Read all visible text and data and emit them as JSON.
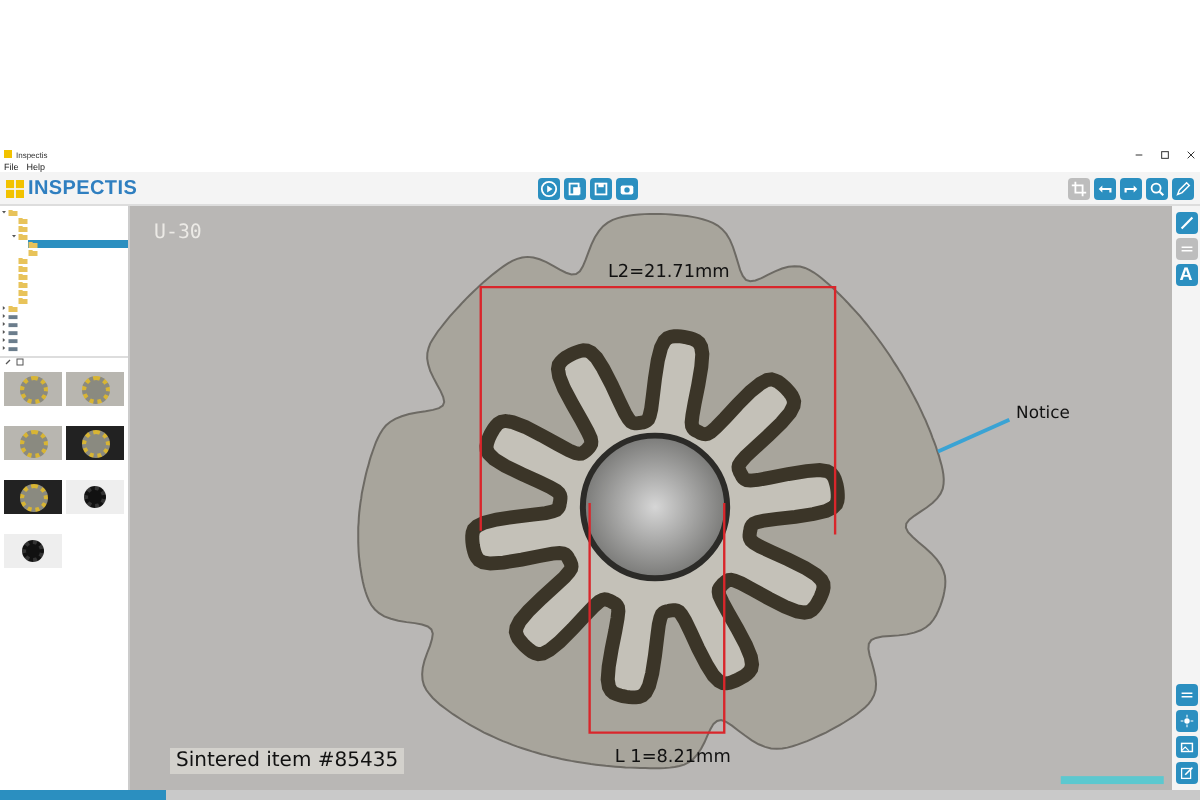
{
  "window": {
    "title": "Inspectis"
  },
  "menu": [
    "File",
    "Help"
  ],
  "logo": {
    "text": "INSPECTIS"
  },
  "center_tools": [
    {
      "kind": "play",
      "disabled": false
    },
    {
      "kind": "copy",
      "disabled": false
    },
    {
      "kind": "save",
      "disabled": false
    },
    {
      "kind": "camera",
      "disabled": false
    }
  ],
  "right_tools": [
    {
      "kind": "crop",
      "disabled": true
    },
    {
      "kind": "undo",
      "disabled": false
    },
    {
      "kind": "redo",
      "disabled": false
    },
    {
      "kind": "zoom",
      "disabled": false
    },
    {
      "kind": "pen",
      "disabled": false
    }
  ],
  "tree": [
    {
      "kind": "folder",
      "selected": false,
      "expanded": true,
      "children": [
        {
          "kind": "folder",
          "selected": false
        },
        {
          "kind": "folder",
          "selected": false
        },
        {
          "kind": "folder",
          "selected": false,
          "expanded": true,
          "children": [
            {
              "kind": "folder",
              "selected": true
            },
            {
              "kind": "folder",
              "selected": false
            }
          ]
        },
        {
          "kind": "folder",
          "selected": false
        },
        {
          "kind": "folder",
          "selected": false
        },
        {
          "kind": "folder",
          "selected": false
        },
        {
          "kind": "folder",
          "selected": false
        },
        {
          "kind": "folder",
          "selected": false
        },
        {
          "kind": "folder",
          "selected": false
        }
      ]
    },
    {
      "kind": "folder",
      "selected": false,
      "expanded": false
    },
    {
      "kind": "drive",
      "selected": false,
      "expanded": false
    },
    {
      "kind": "drive",
      "selected": false,
      "expanded": false
    },
    {
      "kind": "drive",
      "selected": false,
      "expanded": false
    },
    {
      "kind": "drive",
      "selected": false,
      "expanded": false
    },
    {
      "kind": "drive",
      "selected": false,
      "expanded": false
    }
  ],
  "thumbnails": [
    {
      "kind": "light"
    },
    {
      "kind": "light"
    },
    {
      "kind": "light"
    },
    {
      "kind": "dark"
    },
    {
      "kind": "dark"
    },
    {
      "kind": "white"
    },
    {
      "kind": "white"
    }
  ],
  "image": {
    "overlay_label": "U-30",
    "caption": "Sintered item #85435",
    "annotations": [
      {
        "kind": "dimension",
        "text": "L2=21.71mm"
      },
      {
        "kind": "dimension",
        "text": "L 1=8.21mm"
      },
      {
        "kind": "note",
        "text": "Notice"
      }
    ]
  },
  "side_tools_top": [
    {
      "kind": "pen",
      "disabled": false
    },
    {
      "kind": "lines",
      "disabled": true
    },
    {
      "kind": "text",
      "label": "A",
      "disabled": false
    }
  ],
  "side_tools_bottom": [
    {
      "kind": "lines",
      "disabled": false
    },
    {
      "kind": "brightness",
      "disabled": false
    },
    {
      "kind": "images",
      "disabled": false
    },
    {
      "kind": "edit",
      "disabled": false
    }
  ]
}
